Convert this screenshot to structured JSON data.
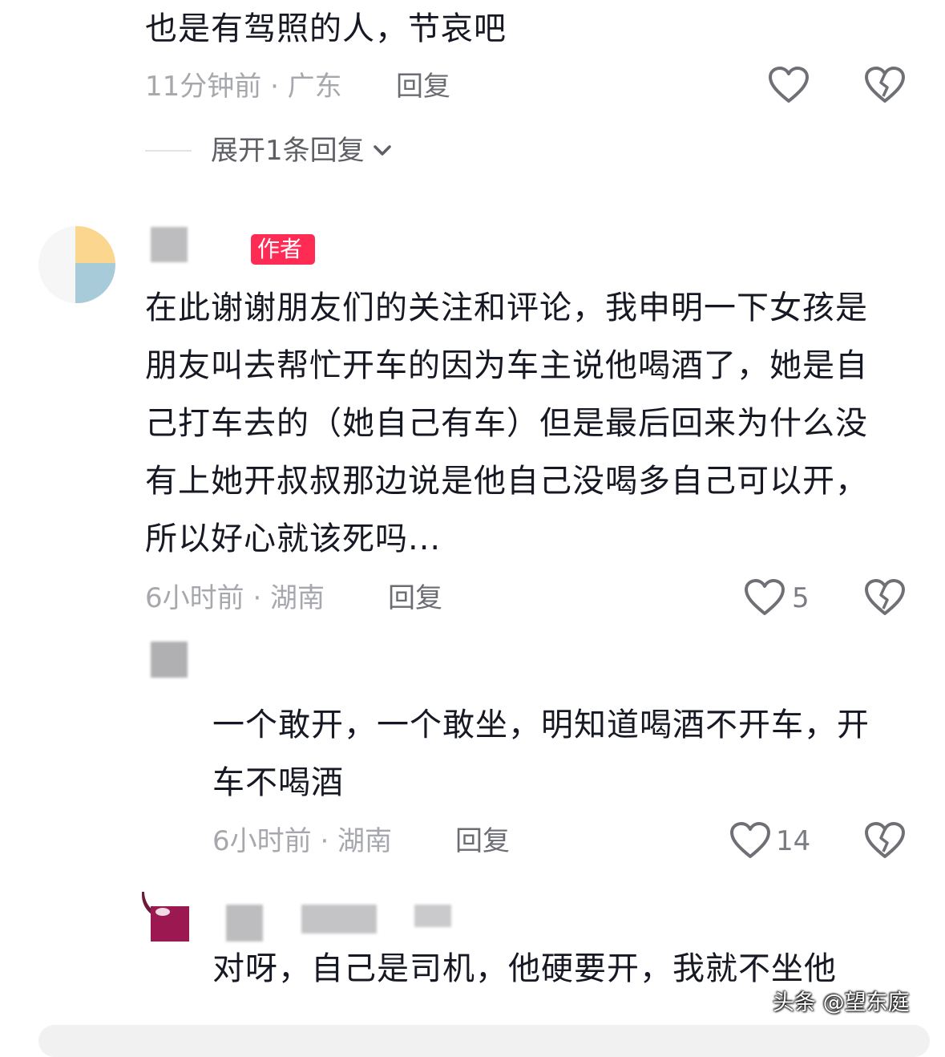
{
  "comments": [
    {
      "text": "也是有驾照的人，节哀吧",
      "meta": "11分钟前 · 广东",
      "reply": "回复",
      "expand": "展开1条回复"
    },
    {
      "badge": "作者",
      "text": "在此谢谢朋友们的关注和评论，我申明一下女孩是朋友叫去帮忙开车的因为车主说他喝酒了，她是自己打车去的（她自己有车）但是最后回来为什么没有上她开叔叔那边说是他自己没喝多自己可以开，所以好心就该死吗...",
      "meta": "6小时前 · 湖南",
      "reply": "回复",
      "likes": "5"
    },
    {
      "text": "一个敢开，一个敢坐，明知道喝酒不开车，开车不喝酒",
      "meta": "6小时前 · 湖南",
      "reply": "回复",
      "likes": "14"
    },
    {
      "text": "对呀，自己是司机，他硬要开，我就不坐他"
    }
  ],
  "watermark": "头条 @望东庭",
  "icons": {
    "like": "heart-icon",
    "dislike": "broken-heart-icon",
    "expand": "chevron-down-icon"
  },
  "colors": {
    "badge": "#fe2c55",
    "text": "#161823",
    "meta": "#a6a8ad"
  }
}
